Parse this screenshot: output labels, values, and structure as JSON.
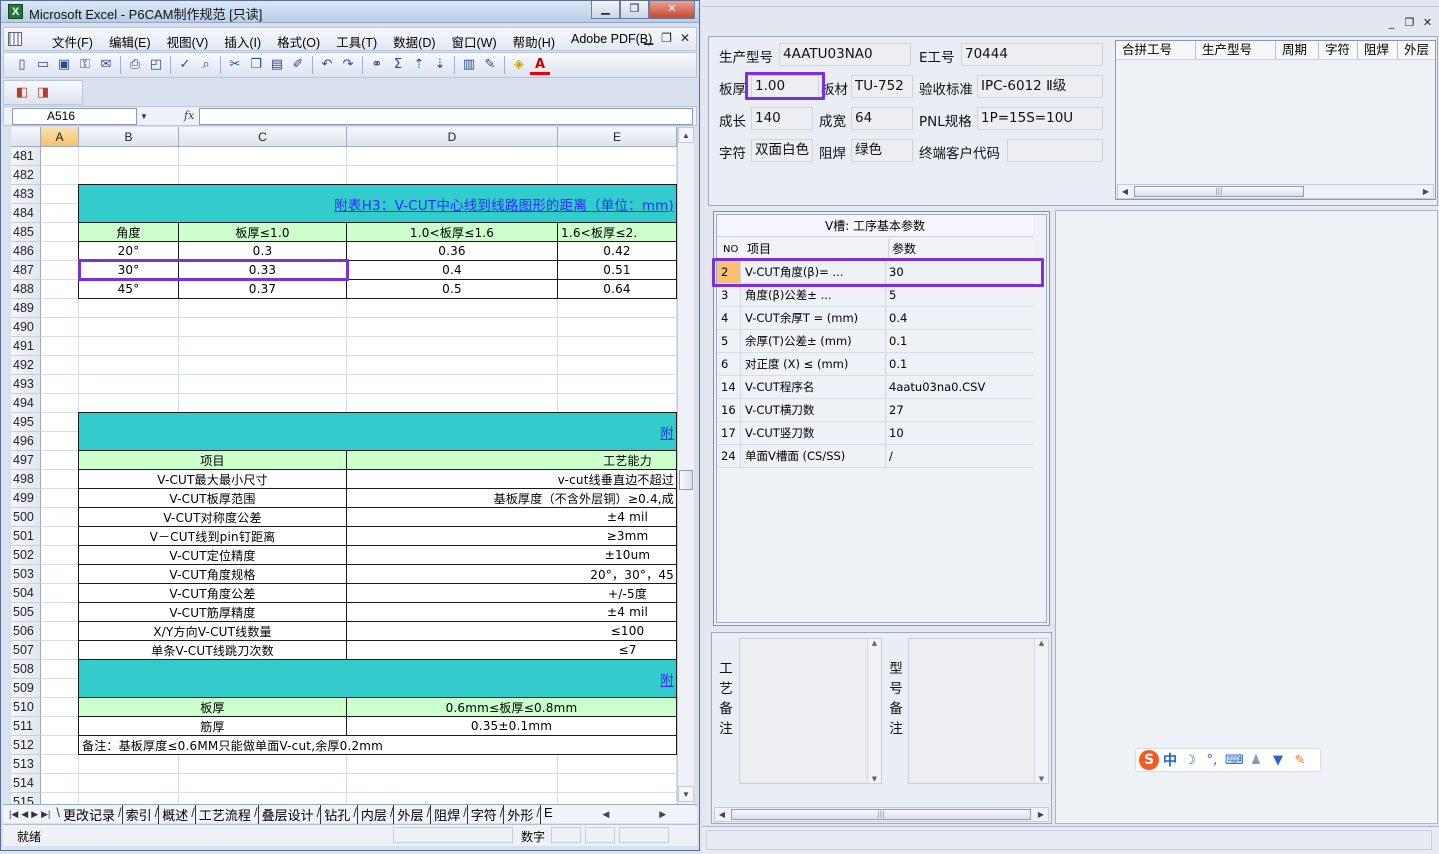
{
  "excel": {
    "title": "Microsoft Excel - P6CAM制作规范  [只读]",
    "window_controls": [
      "minimize-icon",
      "restore-icon",
      "close-icon"
    ],
    "menus": [
      "文件(F)",
      "编辑(E)",
      "视图(V)",
      "插入(I)",
      "格式(O)",
      "工具(T)",
      "数据(D)",
      "窗口(W)",
      "帮助(H)",
      "Adobe PDF(B)"
    ],
    "toolbar1": [
      "new-icon",
      "open-icon",
      "save-icon",
      "permission-icon",
      "email-icon",
      "|",
      "print-icon",
      "print-preview-icon",
      "|",
      "spelling-icon",
      "research-icon",
      "|",
      "cut-icon",
      "copy-icon",
      "paste-icon",
      "format-painter-icon",
      "|",
      "undo-icon",
      "redo-icon",
      "|",
      "hyperlink-icon",
      "autosum-icon",
      "sort-ascending-icon",
      "sort-descending-icon",
      "|",
      "chart-wizard-icon",
      "drawing-icon",
      "|",
      "fill-color-icon",
      "font-color-icon"
    ],
    "toolbar2": [
      "pdf-convert-icon",
      "pdf-email-icon"
    ],
    "name_box": "A516",
    "fx_label": "fx",
    "columns": [
      "A",
      "B",
      "C",
      "D",
      "E"
    ],
    "selected_column": "A",
    "row_numbers": [
      "481",
      "482",
      "483",
      "484",
      "485",
      "486",
      "487",
      "488",
      "489",
      "490",
      "491",
      "492",
      "493",
      "494",
      "495",
      "496",
      "497",
      "498",
      "499",
      "500",
      "501",
      "502",
      "503",
      "504",
      "505",
      "506",
      "507",
      "508",
      "509",
      "510",
      "511",
      "512",
      "513",
      "514",
      "515"
    ],
    "cells": [
      {
        "r": 483,
        "rs": 2,
        "c": "B",
        "ce": "F",
        "t": "附表H3：V-CUT中心线到线路图形的距离（单位：mm)",
        "fill": "teal",
        "align": "right",
        "link": true
      },
      {
        "r": 485,
        "c": "B",
        "ce": "C",
        "t": "角度",
        "fill": "green"
      },
      {
        "r": 485,
        "c": "C",
        "ce": "D",
        "t": "板厚≤1.0",
        "fill": "green"
      },
      {
        "r": 485,
        "c": "D",
        "ce": "E",
        "t": "1.0<板厚≤1.6",
        "fill": "green"
      },
      {
        "r": 485,
        "c": "E",
        "ce": "F",
        "t": "1.6<板厚≤2.",
        "fill": "green",
        "align": "left"
      },
      {
        "r": 486,
        "c": "B",
        "ce": "C",
        "t": "20°"
      },
      {
        "r": 486,
        "c": "C",
        "ce": "D",
        "t": "0.3"
      },
      {
        "r": 486,
        "c": "D",
        "ce": "E",
        "t": "0.36"
      },
      {
        "r": 486,
        "c": "E",
        "ce": "F",
        "t": "0.42"
      },
      {
        "r": 487,
        "c": "B",
        "ce": "C",
        "t": "30°"
      },
      {
        "r": 487,
        "c": "C",
        "ce": "D",
        "t": "0.33"
      },
      {
        "r": 487,
        "c": "D",
        "ce": "E",
        "t": "0.4"
      },
      {
        "r": 487,
        "c": "E",
        "ce": "F",
        "t": "0.51"
      },
      {
        "r": 488,
        "c": "B",
        "ce": "C",
        "t": "45°"
      },
      {
        "r": 488,
        "c": "C",
        "ce": "D",
        "t": "0.37"
      },
      {
        "r": 488,
        "c": "D",
        "ce": "E",
        "t": "0.5"
      },
      {
        "r": 488,
        "c": "E",
        "ce": "F",
        "t": "0.64"
      },
      {
        "r": 495,
        "rs": 2,
        "c": "B",
        "ce": "F",
        "t": "附",
        "fill": "teal",
        "align": "right",
        "link": true
      },
      {
        "r": 497,
        "c": "B",
        "ce": "D",
        "t": "项目",
        "fill": "green"
      },
      {
        "r": 497,
        "c": "D",
        "ce": "F",
        "t": "工艺能力",
        "fill": "green",
        "align": "far"
      },
      {
        "r": 498,
        "c": "B",
        "ce": "D",
        "t": "V-CUT最大最小尺寸"
      },
      {
        "r": 498,
        "c": "D",
        "ce": "F",
        "t": "v-cut线垂直边不超过",
        "align": "right"
      },
      {
        "r": 499,
        "c": "B",
        "ce": "D",
        "t": "V-CUT板厚范围"
      },
      {
        "r": 499,
        "c": "D",
        "ce": "F",
        "t": "基板厚度（不含外层铜）≥0.4,成",
        "align": "right"
      },
      {
        "r": 500,
        "c": "B",
        "ce": "D",
        "t": "V-CUT对称度公差"
      },
      {
        "r": 500,
        "c": "D",
        "ce": "F",
        "t": "±4 mil",
        "align": "far"
      },
      {
        "r": 501,
        "c": "B",
        "ce": "D",
        "t": "V－CUT线到pin钉距离"
      },
      {
        "r": 501,
        "c": "D",
        "ce": "F",
        "t": "≥3mm",
        "align": "far"
      },
      {
        "r": 502,
        "c": "B",
        "ce": "D",
        "t": "V-CUT定位精度"
      },
      {
        "r": 502,
        "c": "D",
        "ce": "F",
        "t": "±10um",
        "align": "far"
      },
      {
        "r": 503,
        "c": "B",
        "ce": "D",
        "t": "V-CUT角度规格"
      },
      {
        "r": 503,
        "c": "D",
        "ce": "F",
        "t": "20°，30°，45",
        "align": "right"
      },
      {
        "r": 504,
        "c": "B",
        "ce": "D",
        "t": "V-CUT角度公差"
      },
      {
        "r": 504,
        "c": "D",
        "ce": "F",
        "t": "+/-5度",
        "align": "far"
      },
      {
        "r": 505,
        "c": "B",
        "ce": "D",
        "t": "V-CUT筋厚精度"
      },
      {
        "r": 505,
        "c": "D",
        "ce": "F",
        "t": "±4 mil",
        "align": "far"
      },
      {
        "r": 506,
        "c": "B",
        "ce": "D",
        "t": "X/Y方向V-CUT线数量"
      },
      {
        "r": 506,
        "c": "D",
        "ce": "F",
        "t": "≤100",
        "align": "far"
      },
      {
        "r": 507,
        "c": "B",
        "ce": "D",
        "t": "单条V-CUT线跳刀次数"
      },
      {
        "r": 507,
        "c": "D",
        "ce": "F",
        "t": "≤7",
        "align": "far"
      },
      {
        "r": 508,
        "rs": 2,
        "c": "B",
        "ce": "F",
        "t": "附",
        "fill": "teal",
        "align": "right",
        "link": true
      },
      {
        "r": 510,
        "c": "B",
        "ce": "D",
        "t": "板厚",
        "fill": "green"
      },
      {
        "r": 510,
        "c": "D",
        "ce": "F",
        "t": "0.6mm≤板厚≤0.8mm",
        "fill": "green"
      },
      {
        "r": 511,
        "c": "B",
        "ce": "D",
        "t": "筋厚"
      },
      {
        "r": 511,
        "c": "D",
        "ce": "F",
        "t": "0.35±0.1mm"
      },
      {
        "r": 512,
        "c": "B",
        "ce": "F",
        "t": "备注：基板厚度≤0.6MM只能做单面V-cut,余厚0.2mm",
        "align": "left"
      }
    ],
    "sheet_tabs": [
      "更改记录",
      "索引",
      "概述",
      "工艺流程",
      "叠层设计",
      "钻孔",
      "内层",
      "外层",
      "阻焊",
      "字符",
      "外形",
      "E"
    ],
    "status_left": "就绪",
    "status_num": "数字"
  },
  "app": {
    "header": {
      "prod_label": "生产型号",
      "prod": "4AATU03NA0",
      "e_label": "E工号",
      "e": "70444",
      "thick_label": "板厚",
      "thick": "1.00",
      "mat_label": "板材",
      "mat": "TU-752",
      "std_label": "验收标准",
      "std": "IPC-6012 Ⅱ级",
      "len_label": "成长",
      "len": "140",
      "wid_label": "成宽",
      "wid": "64",
      "pnl_label": "PNL规格",
      "pnl": "1P=15S=10U",
      "char_label": "字符",
      "char": "双面白色",
      "mask_label": "阻焊",
      "mask": "绿色",
      "cust_label": "终端客户代码",
      "cust": ""
    },
    "merge_table": {
      "columns": [
        "合拼工号",
        "生产型号",
        "周期",
        "字符",
        "阻焊",
        "外层"
      ]
    },
    "vcut": {
      "title": "V槽: 工序基本参数",
      "headers": [
        "NO",
        "项目",
        "参数"
      ],
      "rows": [
        {
          "no": "2",
          "item": "V-CUT角度(β)=   ...",
          "param": "30",
          "selected": true
        },
        {
          "no": "3",
          "item": "角度(β)公差±   ...",
          "param": "5"
        },
        {
          "no": "4",
          "item": "V-CUT余厚T =   (mm)",
          "param": "0.4"
        },
        {
          "no": "5",
          "item": "余厚(T)公差±   (mm)",
          "param": "0.1"
        },
        {
          "no": "6",
          "item": "对正度 (X) ≤  (mm)",
          "param": "0.1"
        },
        {
          "no": "14",
          "item": "V-CUT程序名",
          "param": "4aatu03na0.CSV"
        },
        {
          "no": "16",
          "item": "V-CUT横刀数",
          "param": "27"
        },
        {
          "no": "17",
          "item": "V-CUT竖刀数",
          "param": "10"
        },
        {
          "no": "24",
          "item": "单面V槽面 (CS/SS)",
          "param": "/"
        }
      ]
    },
    "remarks": {
      "process_label": [
        "工",
        "艺",
        "备",
        "注"
      ],
      "model_label": [
        "型",
        "号",
        "备",
        "注"
      ]
    },
    "ime": {
      "logo": "S",
      "mode": "中",
      "icons": [
        "moon-icon",
        "punctuation-icon",
        "keyboard-icon",
        "user-icon",
        "skin-icon",
        "settings-wrench-icon"
      ]
    }
  },
  "colors": {
    "teal": "#33CCCC",
    "green": "#CCFFCC",
    "link": "#2b2bff",
    "highlight": "#7B2FE0",
    "selected_no": "#F8C272"
  }
}
